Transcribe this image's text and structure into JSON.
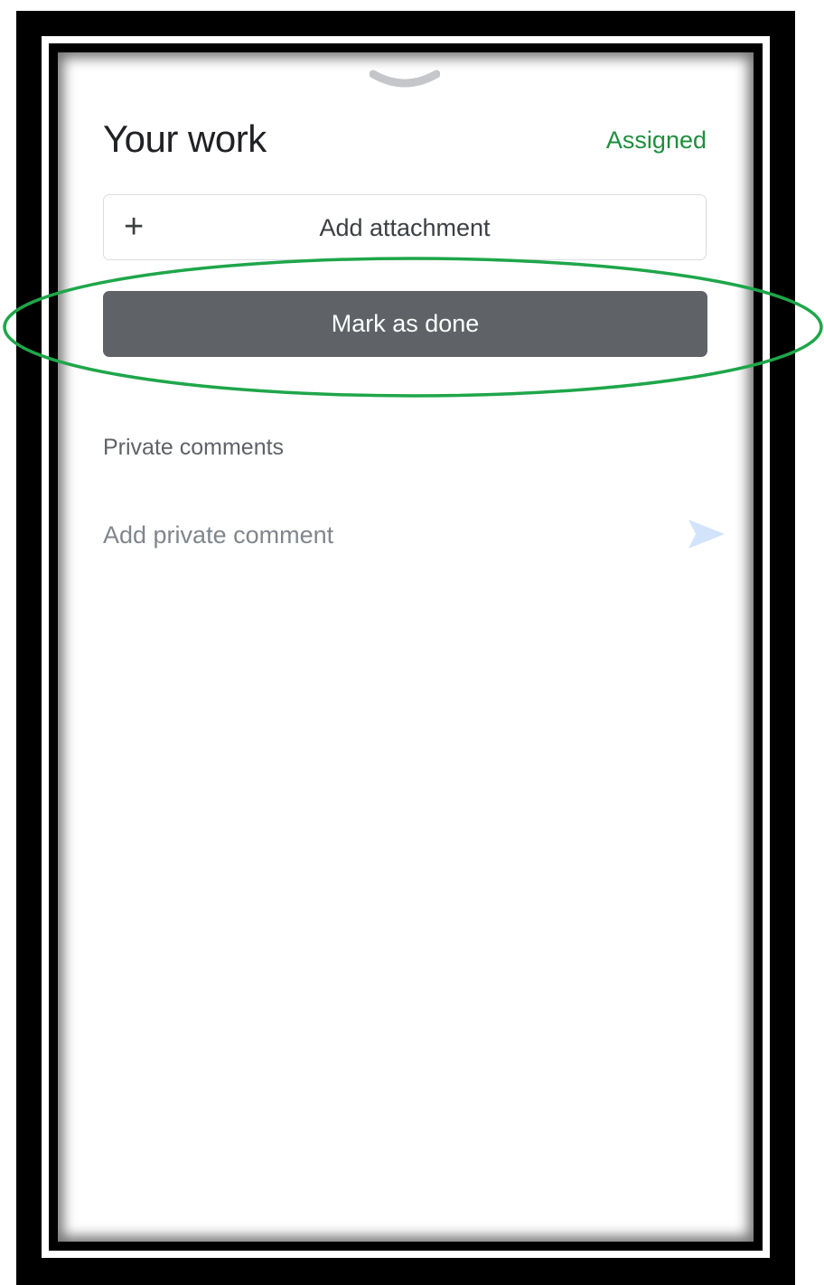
{
  "header": {
    "title": "Your work",
    "status": "Assigned"
  },
  "actions": {
    "attach_label": "Add attachment",
    "done_label": "Mark as done"
  },
  "comments": {
    "heading": "Private comments",
    "placeholder": "Add private comment",
    "value": ""
  },
  "icons": {
    "drag_handle": "chevron-down-icon",
    "attach": "plus-icon",
    "send": "send-icon"
  },
  "colors": {
    "status": "#1e8e3e",
    "done_button": "#5f6368",
    "send_icon": "#d2e3fc",
    "highlight": "#1ea64a"
  }
}
